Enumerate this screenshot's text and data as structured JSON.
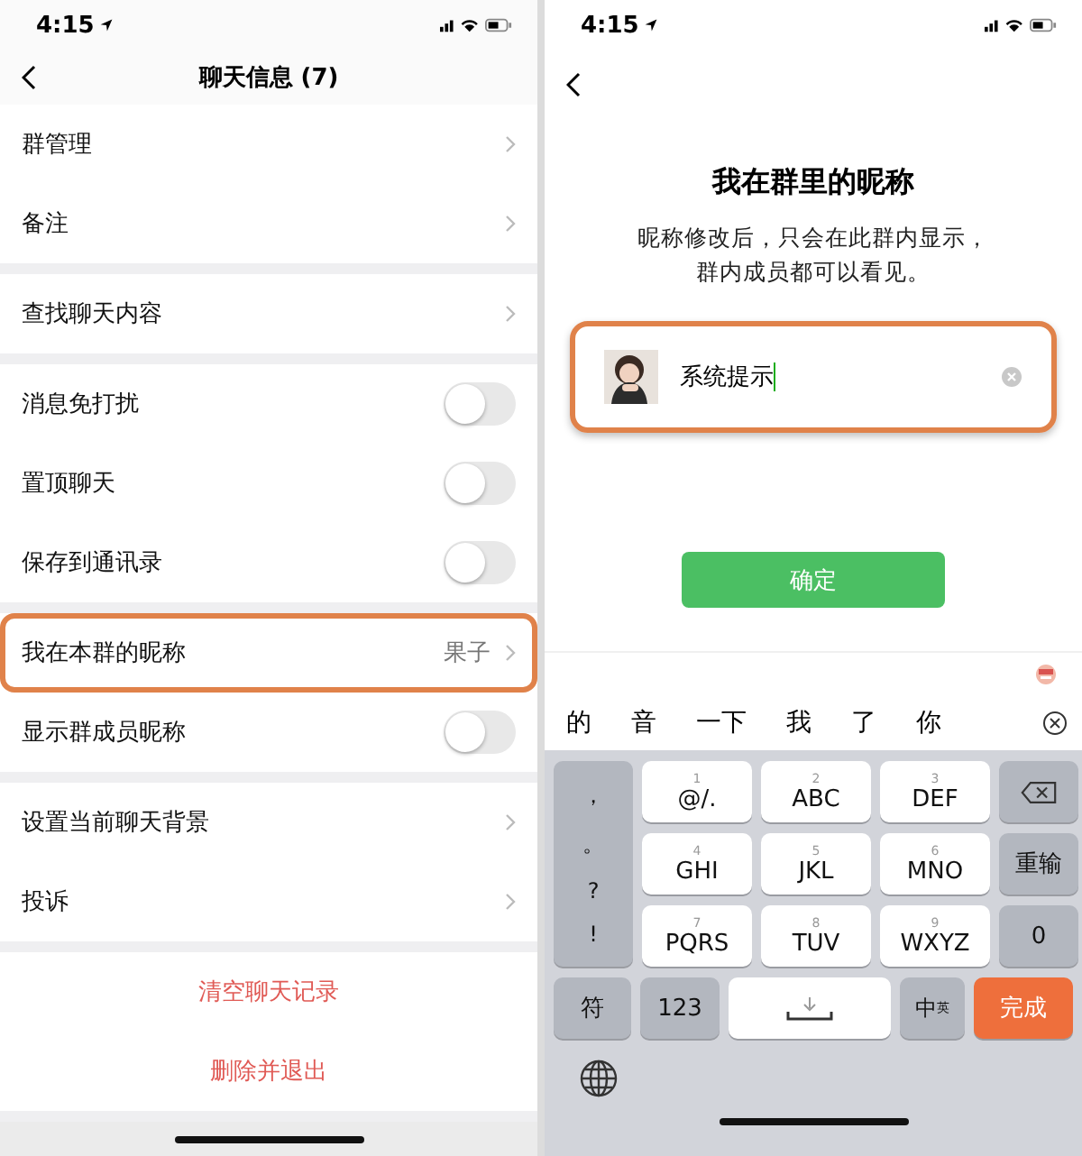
{
  "left_screen": {
    "status_bar": {
      "time": "4:15"
    },
    "nav": {
      "title": "聊天信息 (7)"
    },
    "sections": [
      {
        "items": [
          {
            "label": "群管理",
            "kind": "link",
            "highlighted": false
          },
          {
            "label": "备注",
            "kind": "link",
            "highlighted": false
          }
        ]
      },
      {
        "items": [
          {
            "label": "查找聊天内容",
            "kind": "link",
            "highlighted": false
          }
        ]
      },
      {
        "items": [
          {
            "label": "消息免打扰",
            "kind": "toggle",
            "on": false,
            "highlighted": false
          },
          {
            "label": "置顶聊天",
            "kind": "toggle",
            "on": false,
            "highlighted": false
          },
          {
            "label": "保存到通讯录",
            "kind": "toggle",
            "on": false,
            "highlighted": false
          }
        ]
      },
      {
        "items": [
          {
            "label": "我在本群的昵称",
            "kind": "link",
            "value": "果子",
            "highlighted": true
          },
          {
            "label": "显示群成员昵称",
            "kind": "toggle",
            "on": false,
            "highlighted": false
          }
        ]
      },
      {
        "items": [
          {
            "label": "设置当前聊天背景",
            "kind": "link",
            "highlighted": false
          },
          {
            "label": "投诉",
            "kind": "link",
            "highlighted": false
          }
        ]
      }
    ],
    "actions": [
      "清空聊天记录",
      "删除并退出"
    ]
  },
  "right_screen": {
    "status_bar": {
      "time": "4:15"
    },
    "title": "我在群里的昵称",
    "description": "昵称修改后，只会在此群内显示，群内成员都可以看见。",
    "nickname_field": {
      "value": "系统提示",
      "highlighted": true
    },
    "confirm_button": "确定",
    "keyboard": {
      "candidates": [
        "的",
        "音",
        "一下",
        "我",
        "了",
        "你"
      ],
      "punctuation": [
        "，",
        "。",
        "?",
        "!"
      ],
      "keys": [
        {
          "hint": "1",
          "label": "@/."
        },
        {
          "hint": "2",
          "label": "ABC"
        },
        {
          "hint": "3",
          "label": "DEF"
        },
        {
          "hint": "4",
          "label": "GHI"
        },
        {
          "hint": "5",
          "label": "JKL"
        },
        {
          "hint": "6",
          "label": "MNO"
        },
        {
          "hint": "7",
          "label": "PQRS"
        },
        {
          "hint": "8",
          "label": "TUV"
        },
        {
          "hint": "9",
          "label": "WXYZ"
        }
      ],
      "side_keys": [
        "重输",
        "0"
      ],
      "bottom_keys": {
        "symbols": "符",
        "numbers": "123",
        "language": "中",
        "language_sub": "英",
        "done": "完成"
      }
    }
  }
}
